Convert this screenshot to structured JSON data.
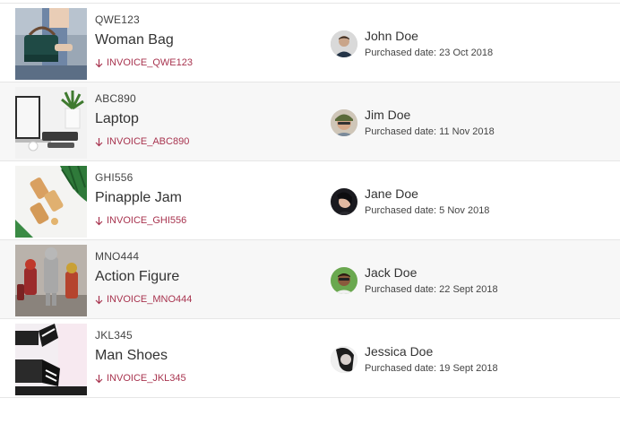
{
  "orders": [
    {
      "sku": "QWE123",
      "product": "Woman Bag",
      "invoice": "INVOICE_QWE123",
      "buyer": "John Doe",
      "purchased": "Purchased date: 23 Oct 2018"
    },
    {
      "sku": "ABC890",
      "product": "Laptop",
      "invoice": "INVOICE_ABC890",
      "buyer": "Jim Doe",
      "purchased": "Purchased date: 11 Nov 2018"
    },
    {
      "sku": "GHI556",
      "product": "Pinapple Jam",
      "invoice": "INVOICE_GHI556",
      "buyer": "Jane Doe",
      "purchased": "Purchased date: 5 Nov 2018"
    },
    {
      "sku": "MNO444",
      "product": "Action Figure",
      "invoice": "INVOICE_MNO444",
      "buyer": "Jack Doe",
      "purchased": "Purchased date: 22 Sept 2018"
    },
    {
      "sku": "JKL345",
      "product": "Man Shoes",
      "invoice": "INVOICE_JKL345",
      "buyer": "Jessica Doe",
      "purchased": "Purchased date: 19 Sept 2018"
    }
  ],
  "colors": {
    "invoice_link": "#a8344f",
    "row_alt_bg": "#f7f7f7",
    "divider": "#e6e6e6"
  },
  "icons": {
    "invoice": "arrow-down-icon"
  }
}
